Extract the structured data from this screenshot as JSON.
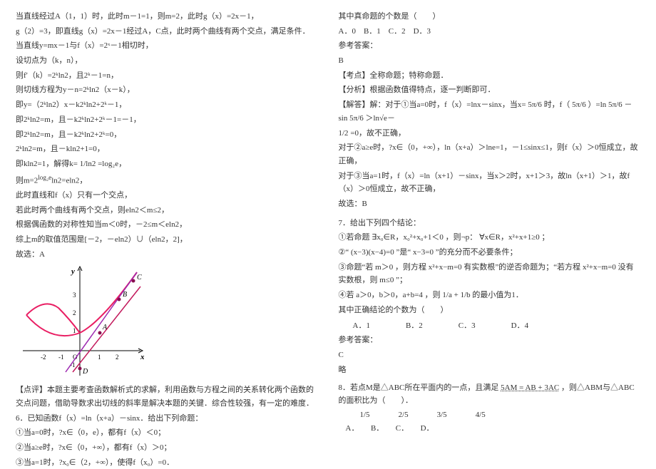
{
  "left": {
    "l1": "当直线经过A（1，1）时，此时m－1=1，则m=2，此时g（x）=2x－1，",
    "l2": "g（2）=3，即直线g（x）=2x－1经过A，C点，此时两个曲线有两个交点，满足条件．",
    "l3": "当直线y=mx－1与f（x）=2ˣ－1相切时，",
    "l4": "设切点为（k，n），",
    "l5": "则f′（k）=2ᵏln2，且2ᵏ－1=n，",
    "l6": "则切线方程为y－n=2ᵏln2（x－k），",
    "l7": "即y=（2ᵏln2）x－k2ᵏln2+2ᵏ－1，",
    "l8": "即2ᵏln2=m，且－k2ᵏln2+2ᵏ－1=－1，",
    "l9": "即2ᵏln2=m，且－k2ᵏln2+2ᵏ=0，",
    "l10": "2ᵏln2=m，且－kln2+1=0，",
    "l11": "即kln2=1，解得k=",
    "l11b": "1/ln2",
    "l11c": "=log₂e，",
    "l12": "则m=2",
    "l12b": "log₂e",
    "l12c": "ln2=eln2，",
    "l13": "此时直线和f（x）只有一个交点，",
    "l14": "若此时两个曲线有两个交点，则eln2＜m≤2，",
    "l15": "根据偶函数的对称性知当m＜0时，－2≤m＜eln2，",
    "l16": "综上m的取值范围是[－2，－eln2）∪（eln2，2]，",
    "l17": "故选：A",
    "l18": "【点评】本题主要考查函数解析式的求解，利用函数与方程之间的关系转化两个函数的交点问题，借助导数求出切线的斜率是解决本题的关键．综合性较强，有一定的难度．",
    "l19": "6．已知函数f（x）=ln（x+a）－sinx．给出下列命题：",
    "l20": "①当a=0时，?x∈（0，e），都有f（x）＜0；",
    "l21": "②当a≥e时，?x∈（0，+∞），都有f（x）＞0；",
    "l22": "③当a=1时，?x₀∈（2，+∞），使得f（x₀）=0．"
  },
  "right": {
    "r1": "其中真命题的个数是（　　）",
    "r2": "A．0　B．1　C．2　D．3",
    "r3": "参考答案：",
    "r4": "B",
    "r5": "【考点】全称命题；特称命题．",
    "r6": "【分析】根据函数值得特点，逐一判断即可．",
    "r7": "【解答】解：对于①当a=0时，f（x）=lnx－sinx，当x=",
    "r7b": "5π/6",
    "r7c": "时，f（",
    "r7d": "5π/6",
    "r7e": "）=ln",
    "r7f": "5π/6",
    "r7g": "－sin",
    "r7h": "5π/6",
    "r7i": "＞ln√e－",
    "r8": "1/2",
    "r8b": "=0，故不正确，",
    "r9": "对于②a≥e时，?x∈（0，+∞），ln（x+a）＞lne=1，－1≤sinx≤1，则f（x）＞0恒成立，故正确，",
    "r10": "对于③当a=1时，f（x）=ln（x+1）－sinx，当x＞2时，x+1＞3，故ln（x+1）＞1，故f（x）＞0恒成立，故不正确，",
    "r11": "故选：B",
    "r12": "7．给出下列四个结论：",
    "r13a": "①若命题",
    "r13b": "∃x₀∈R，x₀²+x₀+1＜0",
    "r13c": "，则¬p：",
    "r13d": "∀x∈R，x²+x+1≥0",
    "r13e": "；",
    "r14a": "②“",
    "r14b": "(x−3)(x−4)=0",
    "r14c": "”是“",
    "r14d": "x−3=0",
    "r14e": "”的充分而不必要条件；",
    "r15a": "③命题“若",
    "r15b": "m＞0",
    "r15c": "，则方程",
    "r15d": "x²+x−m=0",
    "r15e": "有实数根”的逆否命题为；“若方程",
    "r15f": "x²+x−m=0",
    "r15g": "没有实数根，则",
    "r15h": "m≤0",
    "r15i": "”；",
    "r16a": "④若",
    "r16b": "a＞0，b＞0，a+b=4",
    "r16c": "，则",
    "r16d": "1/a + 1/b",
    "r16e": "的最小值为1．",
    "r17": "其中正确结论的个数为（　　）",
    "r18a": "A．1",
    "r18b": "B．2",
    "r18c": "C．3",
    "r18d": "D．4",
    "r19": "参考答案：",
    "r20": "C",
    "r21": "略",
    "r22a": "8．若点M是△ABC所在平面内的一点，且满足",
    "r22b": "5AM = AB + 3AC",
    "r22c": "，则△ABM与△ABC的面积比为（　　）．",
    "r23a": "1/5",
    "r23b": "2/5",
    "r23c": "3/5",
    "r23d": "4/5",
    "r24": "A．　　B．　　C．　　D．"
  }
}
